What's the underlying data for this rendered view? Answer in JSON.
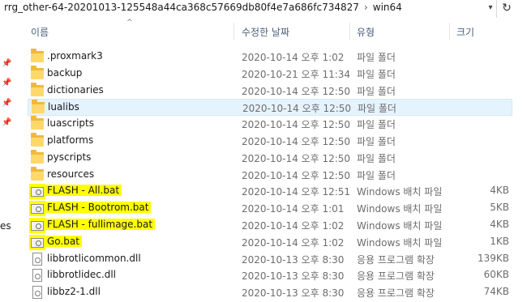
{
  "address": {
    "parent": "rrg_other-64-20201013-125548a44ca368c57669db80f4e7a686fc734827",
    "separator": "›",
    "current": "win64",
    "dropdown_icon": "chevron-down-icon",
    "refresh_icon": "refresh-icon"
  },
  "header": {
    "name": "이름",
    "modified": "수정한 날짜",
    "type": "유형",
    "size": "크기",
    "sort_glyph": "^"
  },
  "left_pane": {
    "partial_label": "es"
  },
  "files": [
    {
      "name": ".proxmark3",
      "modified": "2020-10-14 오후 1:02",
      "type": "파일 폴더",
      "size": "",
      "kind": "folder",
      "highlighted": false,
      "selected": false
    },
    {
      "name": "backup",
      "modified": "2020-10-21 오후 11:34",
      "type": "파일 폴더",
      "size": "",
      "kind": "folder",
      "highlighted": false,
      "selected": false
    },
    {
      "name": "dictionaries",
      "modified": "2020-10-14 오후 12:50",
      "type": "파일 폴더",
      "size": "",
      "kind": "folder",
      "highlighted": false,
      "selected": false
    },
    {
      "name": "lualibs",
      "modified": "2020-10-14 오후 12:50",
      "type": "파일 폴더",
      "size": "",
      "kind": "folder",
      "highlighted": false,
      "selected": true
    },
    {
      "name": "luascripts",
      "modified": "2020-10-14 오후 12:50",
      "type": "파일 폴더",
      "size": "",
      "kind": "folder",
      "highlighted": false,
      "selected": false
    },
    {
      "name": "platforms",
      "modified": "2020-10-14 오후 12:50",
      "type": "파일 폴더",
      "size": "",
      "kind": "folder",
      "highlighted": false,
      "selected": false
    },
    {
      "name": "pyscripts",
      "modified": "2020-10-14 오후 12:50",
      "type": "파일 폴더",
      "size": "",
      "kind": "folder",
      "highlighted": false,
      "selected": false
    },
    {
      "name": "resources",
      "modified": "2020-10-14 오후 12:50",
      "type": "파일 폴더",
      "size": "",
      "kind": "folder",
      "highlighted": false,
      "selected": false
    },
    {
      "name": "FLASH - All.bat",
      "modified": "2020-10-14 오후 12:51",
      "type": "Windows 배치 파일",
      "size": "4KB",
      "kind": "bat",
      "highlighted": true,
      "selected": false
    },
    {
      "name": "FLASH - Bootrom.bat",
      "modified": "2020-10-14 오후 1:01",
      "type": "Windows 배치 파일",
      "size": "5KB",
      "kind": "bat",
      "highlighted": true,
      "selected": false
    },
    {
      "name": "FLASH - fullimage.bat",
      "modified": "2020-10-14 오후 1:02",
      "type": "Windows 배치 파일",
      "size": "4KB",
      "kind": "bat",
      "highlighted": true,
      "selected": false
    },
    {
      "name": "Go.bat",
      "modified": "2020-10-14 오후 1:02",
      "type": "Windows 배치 파일",
      "size": "1KB",
      "kind": "bat",
      "highlighted": true,
      "selected": false
    },
    {
      "name": "libbrotlicommon.dll",
      "modified": "2020-10-13 오후 8:30",
      "type": "응용 프로그램 확장",
      "size": "139KB",
      "kind": "dll",
      "highlighted": false,
      "selected": false
    },
    {
      "name": "libbrotlidec.dll",
      "modified": "2020-10-13 오후 8:30",
      "type": "응용 프로그램 확장",
      "size": "60KB",
      "kind": "dll",
      "highlighted": false,
      "selected": false
    },
    {
      "name": "libbz2-1.dll",
      "modified": "2020-10-13 오후 8:30",
      "type": "응용 프로그램 확장",
      "size": "74KB",
      "kind": "dll",
      "highlighted": false,
      "selected": false
    }
  ],
  "colors": {
    "selection_bg": "#e5f3ff",
    "highlight": "#ffff00",
    "folder": "#ffd86b"
  }
}
